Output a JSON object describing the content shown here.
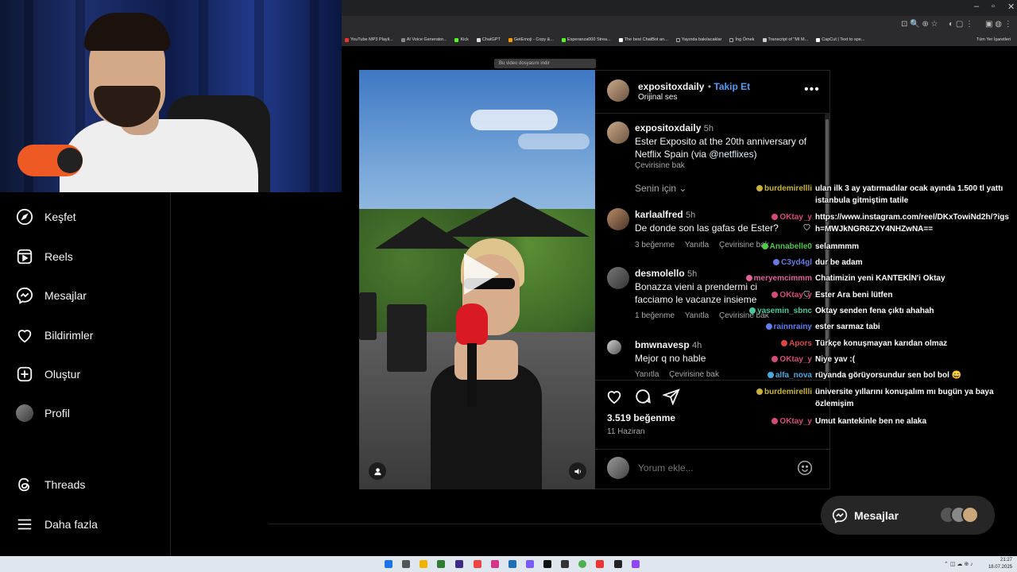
{
  "browser": {
    "bookmarks": [
      "YouTube MP3 Playli...",
      "AI Voice Generator...",
      "Kick",
      "ChatGPT",
      "GetEmoji - Copy &...",
      "Esperanza000 Strea...",
      "The best ChatBot an...",
      "Yayında bakılacaklar",
      "İng Örnek",
      "Transcript of \"MI M...",
      "CapCut | Text to spe..."
    ],
    "bookmarks_right": "Tüm Yer İşaretleri",
    "video_notice": "Bu video dosyasını indir"
  },
  "sidebar": {
    "items": [
      {
        "label": "Keşfet",
        "icon": "compass-icon"
      },
      {
        "label": "Reels",
        "icon": "reels-icon"
      },
      {
        "label": "Mesajlar",
        "icon": "messenger-icon"
      },
      {
        "label": "Bildirimler",
        "icon": "heart-icon"
      },
      {
        "label": "Oluştur",
        "icon": "plus-square-icon"
      },
      {
        "label": "Profil",
        "icon": "avatar"
      }
    ],
    "threads": "Threads",
    "more": "Daha fazla"
  },
  "post": {
    "author": "expositoxdaily",
    "follow": "Takip Et",
    "audio": "Orijinal ses",
    "caption": {
      "user": "expositoxdaily",
      "time": "5h",
      "text": "Ester Exposito at the 20th anniversary of Netflix Spain (via ",
      "mention": "@netflixes",
      "text_end": ")",
      "translate": "Çevirisine bak"
    },
    "sort_label": "Senin için",
    "comments": [
      {
        "user": "karlaalfred",
        "time": "5h",
        "text": "De donde son las gafas de Ester?",
        "likes": "3 beğenme",
        "reply": "Yanıtla",
        "translate": "Çevirisine bak"
      },
      {
        "user": "desmolello",
        "time": "5h",
        "text": "Bonazza vieni a prendermi ci facciamo le vacanze insieme",
        "likes": "1 beğenme",
        "reply": "Yanıtla",
        "translate": "Çevirisine bak"
      },
      {
        "user": "bmwnavesp",
        "time": "4h",
        "text": "Mejor q no hable",
        "likes": "",
        "reply": "Yanıtla",
        "translate": "Çevirisine bak"
      }
    ],
    "likes_count": "3.519 beğenme",
    "date": "11 Haziran",
    "comment_placeholder": "Yorum ekle..."
  },
  "chat": [
    {
      "user": "burdemirellli",
      "color": "#c9b23a",
      "msg": "ulan ilk 3 ay yatırmadılar ocak ayında 1.500 tl yattı istanbula gitmiştim tatile"
    },
    {
      "user": "OKtay_y",
      "color": "#d64a7a",
      "msg": "https://www.instagram.com/reel/DKxTowiNd2h/?igsh=MWJkNGR6ZXY4NHZwNA=="
    },
    {
      "user": "Annabelle0",
      "color": "#4fc94a",
      "msg": "selammmm"
    },
    {
      "user": "C3yd4gl",
      "color": "#6a78e6",
      "msg": "dur be adam"
    },
    {
      "user": "meryemcimmm",
      "color": "#e0619a",
      "msg": "Chatimizin yeni KANTEKİN'i Oktay"
    },
    {
      "user": "OKtay_y",
      "color": "#d64a7a",
      "msg": "Ester Ara beni lütfen"
    },
    {
      "user": "yasemin_sbnc",
      "color": "#4bc7a0",
      "msg": "Oktay senden fena çıktı ahahah"
    },
    {
      "user": "rainnrainy",
      "color": "#5f7ff0",
      "msg": "ester sarmaz tabi"
    },
    {
      "user": "Apors",
      "color": "#e04545",
      "msg": "Türkçe konuşmayan karıdan olmaz"
    },
    {
      "user": "OKtay_y",
      "color": "#d64a7a",
      "msg": "Niye yav :("
    },
    {
      "user": "alfa_nova",
      "color": "#4aa8e0",
      "msg": "rüyanda görüyorsundur sen bol bol 😄"
    },
    {
      "user": "burdemirellli",
      "color": "#c9b23a",
      "msg": "üniversite yıllarını konuşalım mı bugün ya baya özlemişim"
    },
    {
      "user": "OKtay_y",
      "color": "#d64a7a",
      "msg": "Umut kantekinle ben ne alaka"
    }
  ],
  "messages_pill": "Mesajlar",
  "taskbar": {
    "time": "21:27",
    "date": "18.07.2025"
  }
}
